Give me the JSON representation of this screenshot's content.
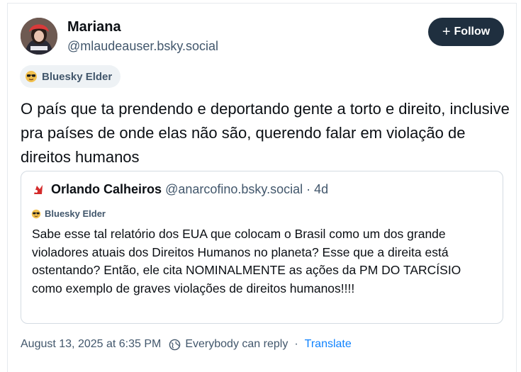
{
  "post": {
    "author": {
      "name": "Mariana",
      "handle": "@mlaudeauser.bsky.social",
      "avatar_icon": "avatar-photo"
    },
    "follow_label": "Follow",
    "badge": {
      "icon": "sunglasses-face-icon",
      "label": "Bluesky Elder"
    },
    "text": "O país que ta prendendo e deportando gente a torto e direito, inclusive pra países de onde elas não são, querendo falar em violação de direitos humanos",
    "quote": {
      "author_name": "Orlando Calheiros",
      "author_handle": "@anarcofino.bsky.social",
      "separator": "·",
      "age": "4d",
      "badge": {
        "icon": "sunglasses-face-icon",
        "label": "Bluesky Elder"
      },
      "text": "Sabe esse tal relatório dos EUA que colocam o Brasil como um dos grande violadores atuais dos Direitos Humanos no planeta? Esse que a direita está ostentando? Então, ele cita NOMINALMENTE as ações da PM DO TARCÍSIO como exemplo de graves violações de direitos humanos!!!!"
    },
    "meta": {
      "timestamp": "August 13, 2025 at 6:35 PM",
      "reply_setting": "Everybody can reply",
      "separator": "·",
      "translate_label": "Translate"
    }
  },
  "colors": {
    "text": "#0b0f14",
    "muted": "#42576c",
    "follow_bg": "#1f2f3f",
    "link": "#1083fe",
    "border": "#d4dbe2"
  }
}
